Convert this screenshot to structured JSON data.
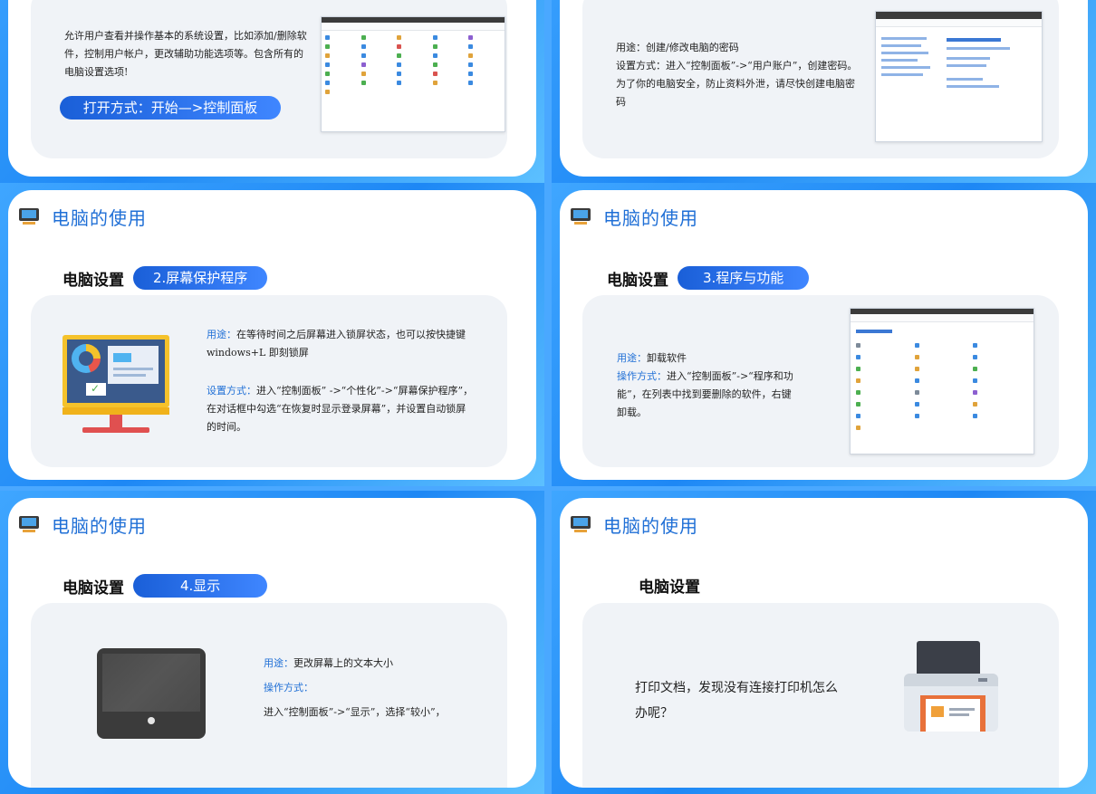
{
  "slides": {
    "tl": {
      "body": "允许用户查看并操作基本的系统设置，比如添加/删除软件，控制用户帐户，更改辅助功能选项等。包含所有的电脑设置选项!",
      "open_button": "打开方式：开始—>控制面板"
    },
    "tr": {
      "lines": [
        "用途：创建/修改电脑的密码",
        "设置方式：进入“控制面板”->“用户账户”，创建密码。",
        "为了你的电脑安全，防止资料外泄，请尽快创建电脑密码"
      ]
    },
    "ml": {
      "header": "电脑的使用",
      "section": "电脑设置",
      "pill": "2.屏幕保护程序",
      "usage_label": "用途：",
      "usage_text": "在等待时间之后屏幕进入锁屏状态，也可以按快捷键 windows+L 即刻锁屏",
      "method_label": "设置方式：",
      "method_text": "进入“控制面板” ->“个性化”->“屏幕保护程序”，在对话框中勾选“在恢复时显示登录屏幕”，并设置自动锁屏的时间。"
    },
    "mr": {
      "header": "电脑的使用",
      "section": "电脑设置",
      "pill": "3.程序与功能",
      "usage_label": "用途：",
      "usage_text": "卸载软件",
      "method_label": "操作方式：",
      "method_text": "进入“控制面板”->“程序和功能”，在列表中找到要删除的软件，右键卸载。"
    },
    "bl": {
      "header": "电脑的使用",
      "section": "电脑设置",
      "pill": "4.显示",
      "usage_label": "用途：",
      "usage_text": "更改屏幕上的文本大小",
      "method_label": "操作方式：",
      "method_text": "进入“控制面板”->“显示”，选择“较小”，"
    },
    "br": {
      "header": "电脑的使用",
      "section": "电脑设置",
      "question": "打印文档，发现没有连接打印机怎么办呢？"
    }
  },
  "colors": {
    "accent": "#1f6fd6",
    "pill": "#2a74f0",
    "panel": "#f0f3f7"
  }
}
